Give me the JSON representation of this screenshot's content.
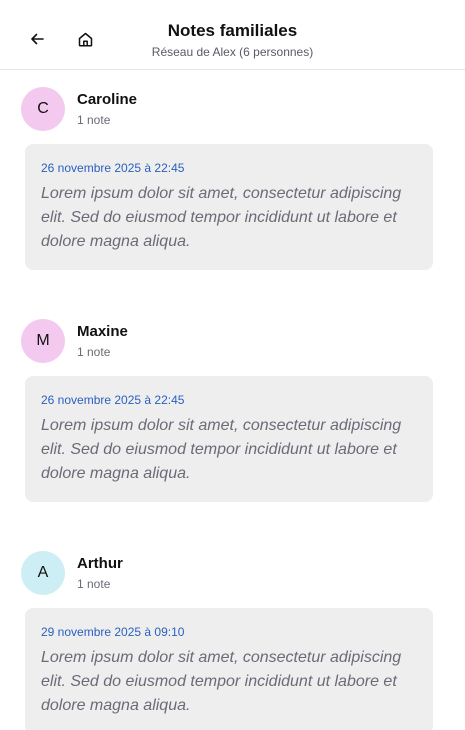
{
  "header": {
    "title": "Notes familiales",
    "subtitle": "Réseau de Alex (6 personnes)",
    "back_icon": "arrow-left-icon",
    "home_icon": "home-icon"
  },
  "people": [
    {
      "initial": "C",
      "name": "Caroline",
      "note_count": "1 note",
      "avatar_color": "#f3c9f0",
      "note": {
        "date": "26 novembre 2025 à 22:45",
        "text": "Lorem ipsum dolor sit amet, consectetur adipiscing elit. Sed do eiusmod tempor incididunt ut labore et dolore magna aliqua."
      }
    },
    {
      "initial": "M",
      "name": "Maxine",
      "note_count": "1 note",
      "avatar_color": "#f3c9f0",
      "note": {
        "date": "26 novembre 2025 à 22:45",
        "text": "Lorem ipsum dolor sit amet, consectetur adipiscing elit. Sed do eiusmod tempor incididunt ut labore et dolore magna aliqua."
      }
    },
    {
      "initial": "A",
      "name": "Arthur",
      "note_count": "1 note",
      "avatar_color": "#cdeef5",
      "note": {
        "date": "29 novembre 2025 à 09:10",
        "text": "Lorem ipsum dolor sit amet, consectetur adipiscing elit. Sed do eiusmod tempor incididunt ut labore et dolore magna aliqua."
      }
    }
  ]
}
